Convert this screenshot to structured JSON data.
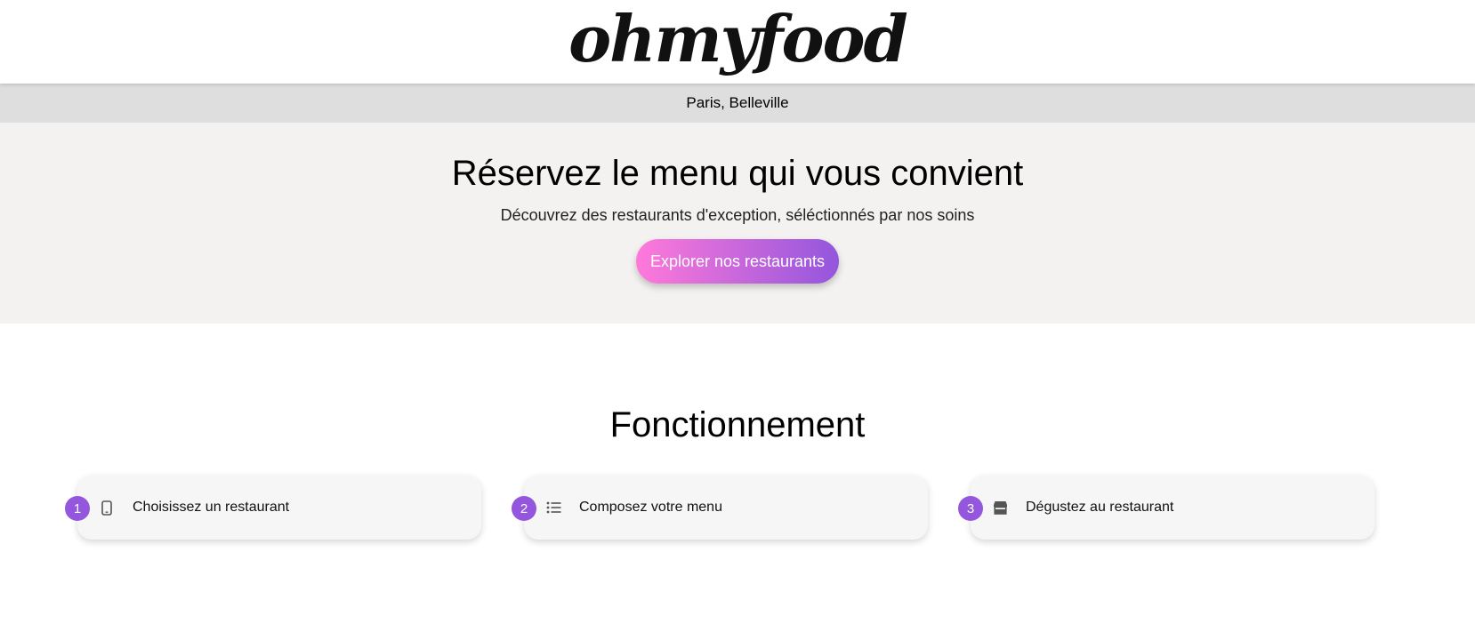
{
  "header": {
    "logo_text": "ohmyfood"
  },
  "location": {
    "text": "Paris, Belleville"
  },
  "hero": {
    "title": "Réservez le menu qui vous convient",
    "subtitle": "Découvrez des restaurants d'exception, séléctionnés par nos soins",
    "button_label": "Explorer nos restaurants"
  },
  "how_it_works": {
    "title": "Fonctionnement",
    "steps": [
      {
        "number": "1",
        "icon": "mobile-phone-icon",
        "label": "Choisissez un restaurant"
      },
      {
        "number": "2",
        "icon": "list-icon",
        "label": "Composez votre menu"
      },
      {
        "number": "3",
        "icon": "store-icon",
        "label": "Dégustez au restaurant"
      }
    ]
  },
  "colors": {
    "accent_purple": "#9356dc",
    "accent_pink": "#ff79da",
    "hero_background": "#f3f2f0",
    "location_bar_background": "#dedede"
  }
}
